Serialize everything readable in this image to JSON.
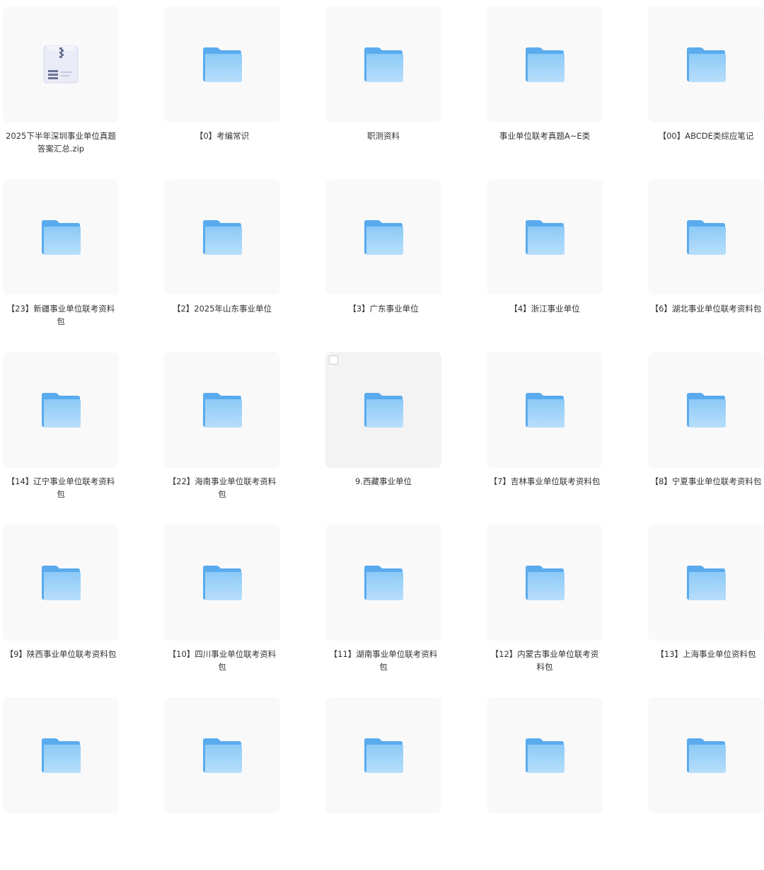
{
  "colors": {
    "tile_bg": "#f9f9fa",
    "tile_hover_bg": "#f3f3f4",
    "folder_back": "#5aabee",
    "folder_front_top": "#8ccaf7",
    "folder_front_bottom": "#b5ddfb",
    "label_text": "#333333"
  },
  "files": [
    {
      "name": "2025下半年深圳事业单位真题答案汇总.zip",
      "icon": "zip-archive-icon",
      "type": "zip"
    },
    {
      "name": "【0】考编常识",
      "icon": "folder-icon",
      "type": "folder"
    },
    {
      "name": "职测资料",
      "icon": "folder-icon",
      "type": "folder"
    },
    {
      "name": "事业单位联考真题A~E类",
      "icon": "folder-icon",
      "type": "folder"
    },
    {
      "name": "【00】ABCDE类综应笔记",
      "icon": "folder-icon",
      "type": "folder"
    },
    {
      "name": "【23】新疆事业单位联考资料包",
      "icon": "folder-icon",
      "type": "folder"
    },
    {
      "name": "【2】2025年山东事业单位",
      "icon": "folder-icon",
      "type": "folder"
    },
    {
      "name": "【3】广东事业单位",
      "icon": "folder-icon",
      "type": "folder"
    },
    {
      "name": "【4】浙江事业单位",
      "icon": "folder-icon",
      "type": "folder"
    },
    {
      "name": "【6】湖北事业单位联考资料包",
      "icon": "folder-icon",
      "type": "folder"
    },
    {
      "name": "【14】辽宁事业单位联考资料包",
      "icon": "folder-icon",
      "type": "folder"
    },
    {
      "name": "【22】海南事业单位联考资料包",
      "icon": "folder-icon",
      "type": "folder"
    },
    {
      "name": "9.西藏事业单位",
      "icon": "folder-icon",
      "type": "folder",
      "hovered": true
    },
    {
      "name": "【7】吉林事业单位联考资料包",
      "icon": "folder-icon",
      "type": "folder"
    },
    {
      "name": "【8】宁夏事业单位联考资料包",
      "icon": "folder-icon",
      "type": "folder"
    },
    {
      "name": "【9】陕西事业单位联考资料包",
      "icon": "folder-icon",
      "type": "folder"
    },
    {
      "name": "【10】四川事业单位联考资料包",
      "icon": "folder-icon",
      "type": "folder"
    },
    {
      "name": "【11】湖南事业单位联考资料包",
      "icon": "folder-icon",
      "type": "folder"
    },
    {
      "name": "【12】内蒙古事业单位联考资料包",
      "icon": "folder-icon",
      "type": "folder"
    },
    {
      "name": "【13】上海事业单位资料包",
      "icon": "folder-icon",
      "type": "folder"
    },
    {
      "name": "",
      "icon": "folder-icon",
      "type": "folder"
    },
    {
      "name": "",
      "icon": "folder-icon",
      "type": "folder"
    },
    {
      "name": "",
      "icon": "folder-icon",
      "type": "folder"
    },
    {
      "name": "",
      "icon": "folder-icon",
      "type": "folder"
    },
    {
      "name": "",
      "icon": "folder-icon",
      "type": "folder"
    }
  ]
}
